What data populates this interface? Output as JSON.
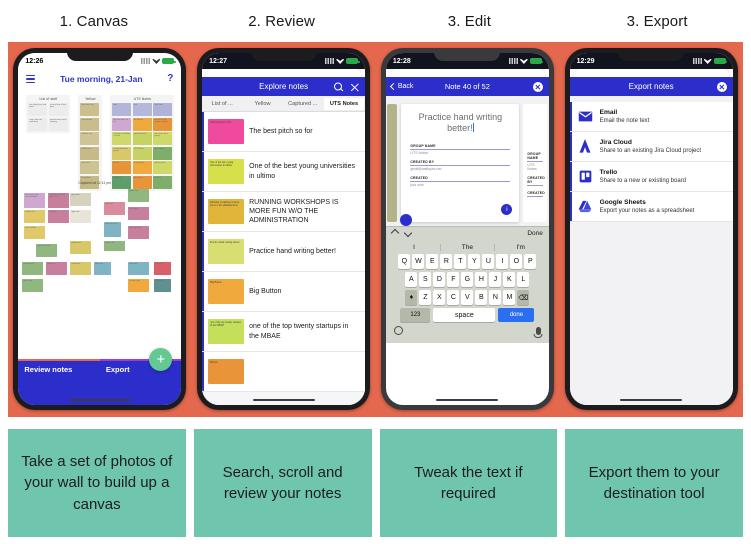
{
  "headers": [
    {
      "label": "1. Canvas"
    },
    {
      "label": "2. Review"
    },
    {
      "label": "3. Edit"
    },
    {
      "label": "3. Export"
    }
  ],
  "colors": {
    "band_background": "#e4684d",
    "caption_background": "#6fc5ae",
    "app_blue": "#2c2ecb",
    "fab_green": "#63c893",
    "tab_accent_orange": "#e4684d",
    "tab_accent_purple": "#a23bd6"
  },
  "phone1": {
    "status": {
      "time": "12:26",
      "signal_icon": "signal-icon",
      "wifi_icon": "wifi-icon",
      "battery_icon": "battery-icon"
    },
    "menu_icon": "hamburger-menu-icon",
    "title": "Tue morning, 21-Jan",
    "help_icon": "question-mark-icon",
    "groups": [
      {
        "label": "List of stuff"
      },
      {
        "label": "Yellow"
      },
      {
        "label": "UTS Notes"
      }
    ],
    "captured_label": "Captured at 12:11 pm",
    "tabs": [
      {
        "label": "Review notes"
      },
      {
        "label": "Export"
      }
    ],
    "fab_label": "+",
    "fab_icon": "plus-icon"
  },
  "phone2": {
    "status": {
      "time": "12:27"
    },
    "title": "Explore notes",
    "search_icon": "search-icon",
    "close_icon": "close-icon",
    "tabs": [
      {
        "label": "List of ..."
      },
      {
        "label": "Yellow"
      },
      {
        "label": "Captured ..."
      },
      {
        "label": "UTS Notes",
        "selected": true
      }
    ],
    "notes": [
      {
        "text": "The best pitch so for",
        "thumb_text": "The best pitch so far",
        "thumb_color": "#ef4a9b"
      },
      {
        "text": "One of the best young universities in ultimo",
        "thumb_text": "One of the best young universities in ultimo",
        "thumb_color": "#d6e04a"
      },
      {
        "text": "RUNNING WORKSHOPS IS MORE FUN W/O THE ADMINISTRATION",
        "thumb_text": "Running workshops is more fun w/o the administration",
        "thumb_color": "#e0b63a"
      },
      {
        "text": "Practice hand writing better!",
        "thumb_text": "Practice hand writing better!",
        "thumb_color": "#d9de72"
      },
      {
        "text": "Big Button",
        "thumb_text": "Big Button",
        "thumb_color": "#f0a93c"
      },
      {
        "text": "one of the top twenty startups in the MBAE",
        "thumb_text": "one of the top twenty startups in the MBAE",
        "thumb_color": "#c4e05a"
      },
      {
        "text": "",
        "thumb_text": "Biscuit",
        "thumb_color": "#e8953a"
      }
    ]
  },
  "phone3": {
    "status": {
      "time": "12:28"
    },
    "back_label": "Back",
    "back_icon": "chevron-left-icon",
    "title": "Note 40 of 52",
    "close_icon": "close-circle-icon",
    "note_text": "Practice hand writing better!",
    "fields": [
      {
        "label": "GROUP NAME",
        "value": "UTS Notes"
      },
      {
        "label": "CREATED BY",
        "value": "geoff@wallsync.net"
      },
      {
        "label": "CREATED",
        "value": "just now"
      }
    ],
    "info_icon": "info-icon",
    "accessory": {
      "up_icon": "chevron-up-icon",
      "down_icon": "chevron-down-icon",
      "done_label": "Done"
    },
    "keyboard": {
      "suggestions": [
        "I",
        "The",
        "I'm"
      ],
      "row1": [
        "Q",
        "W",
        "E",
        "R",
        "T",
        "Y",
        "U",
        "I",
        "O",
        "P"
      ],
      "row2": [
        "A",
        "S",
        "D",
        "F",
        "G",
        "H",
        "J",
        "K",
        "L"
      ],
      "row3": [
        "Z",
        "X",
        "C",
        "V",
        "B",
        "N",
        "M"
      ],
      "shift_icon": "shift-icon",
      "backspace_icon": "backspace-icon",
      "numbers_label": "123",
      "space_label": "space",
      "done_label": "done",
      "emoji_icon": "emoji-icon",
      "mic_icon": "microphone-icon"
    }
  },
  "phone4": {
    "status": {
      "time": "12:29"
    },
    "title": "Export notes",
    "close_icon": "close-circle-icon",
    "options": [
      {
        "name": "Email",
        "description": "Email the note text",
        "icon": "envelope-icon"
      },
      {
        "name": "Jira Cloud",
        "description": "Share to an existing Jira Cloud project",
        "icon": "jira-icon"
      },
      {
        "name": "Trello",
        "description": "Share to a new or existing board",
        "icon": "trello-icon"
      },
      {
        "name": "Google Sheets",
        "description": "Export your notes as a spreadsheet",
        "icon": "google-drive-icon"
      }
    ]
  },
  "captions": [
    {
      "text": "Take a set of photos of your wall to build up a canvas"
    },
    {
      "text": "Search, scroll and review your notes"
    },
    {
      "text": "Tweak the text if required"
    },
    {
      "text": "Export them to your destination tool"
    }
  ]
}
